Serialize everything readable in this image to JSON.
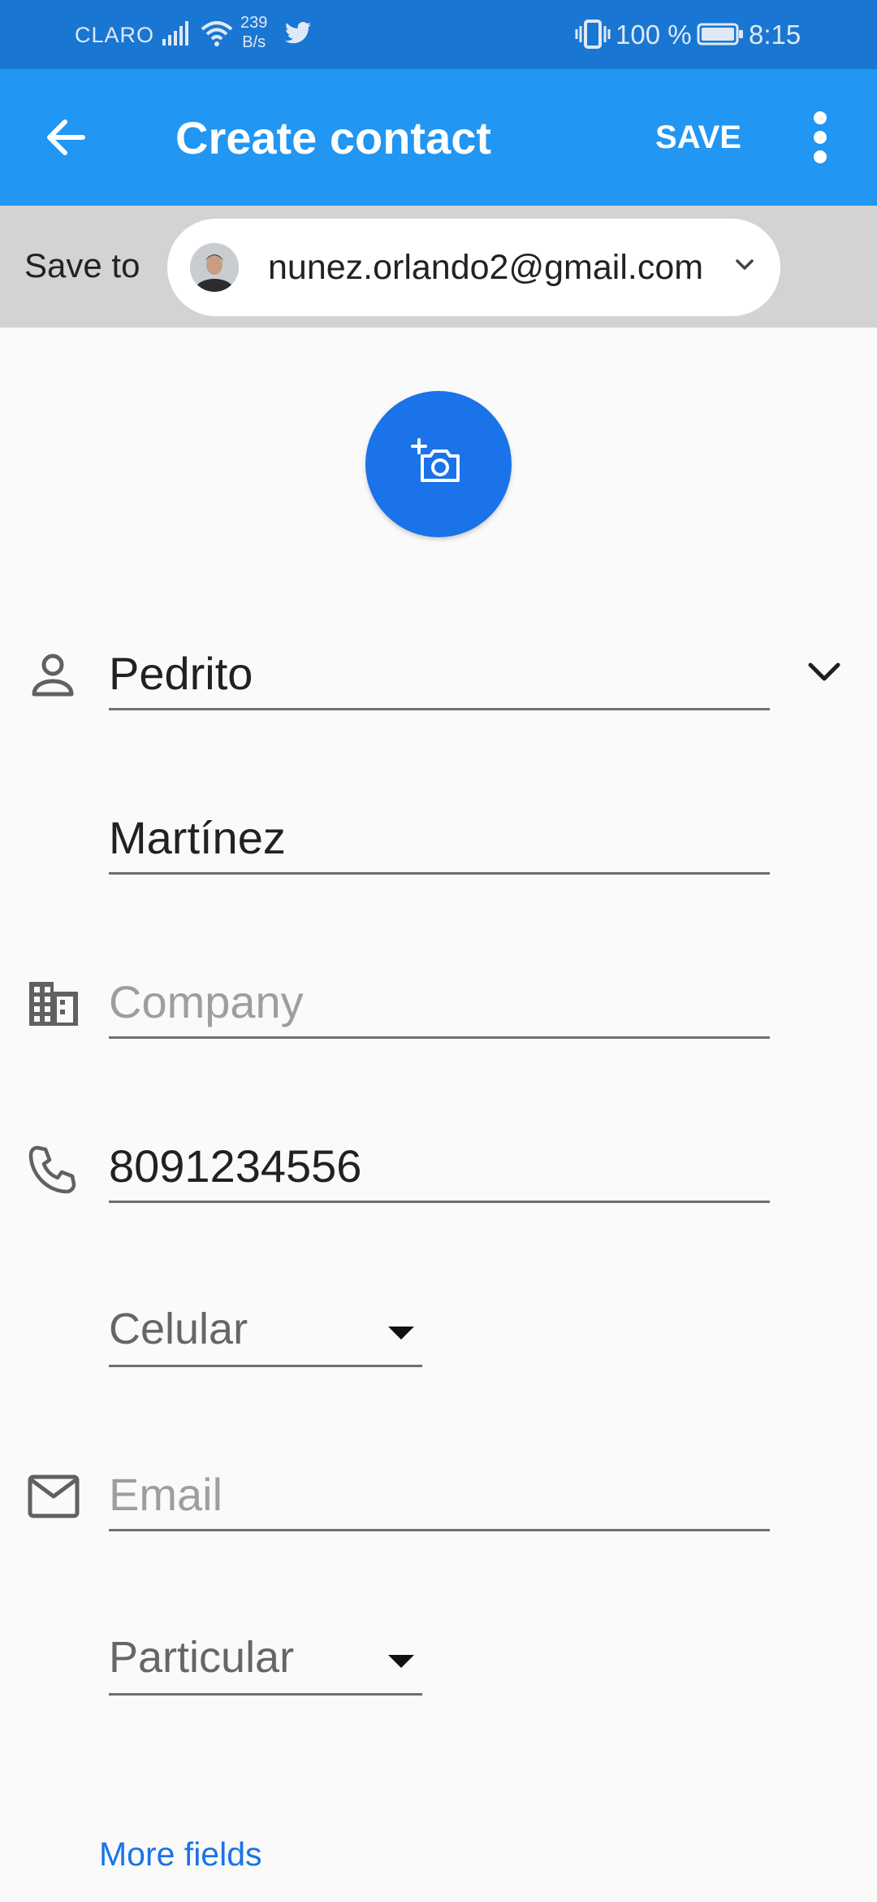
{
  "status_bar": {
    "carrier": "CLARO",
    "speed_value": "239",
    "speed_unit": "B/s",
    "battery": "100 %",
    "time": "8:15"
  },
  "app_bar": {
    "title": "Create contact",
    "save_label": "SAVE"
  },
  "save_to": {
    "label": "Save to",
    "account": "nunez.orlando2@gmail.com"
  },
  "form": {
    "first_name": "Pedrito",
    "last_name": "Martínez",
    "company_placeholder": "Company",
    "phone": "8091234556",
    "phone_type": "Celular",
    "email_placeholder": "Email",
    "email_type": "Particular"
  },
  "more_fields_label": "More fields",
  "colors": {
    "status_bar": "#1976d2",
    "app_bar": "#2196f3",
    "accent": "#1a73e8",
    "save_to_bar": "#d3d3d3",
    "background": "#fafafa"
  },
  "icons": {
    "back": "arrow-left-icon",
    "more": "more-vert-icon",
    "photo": "add-photo-icon",
    "person": "person-icon",
    "company": "business-icon",
    "phone": "phone-icon",
    "email": "mail-icon"
  }
}
